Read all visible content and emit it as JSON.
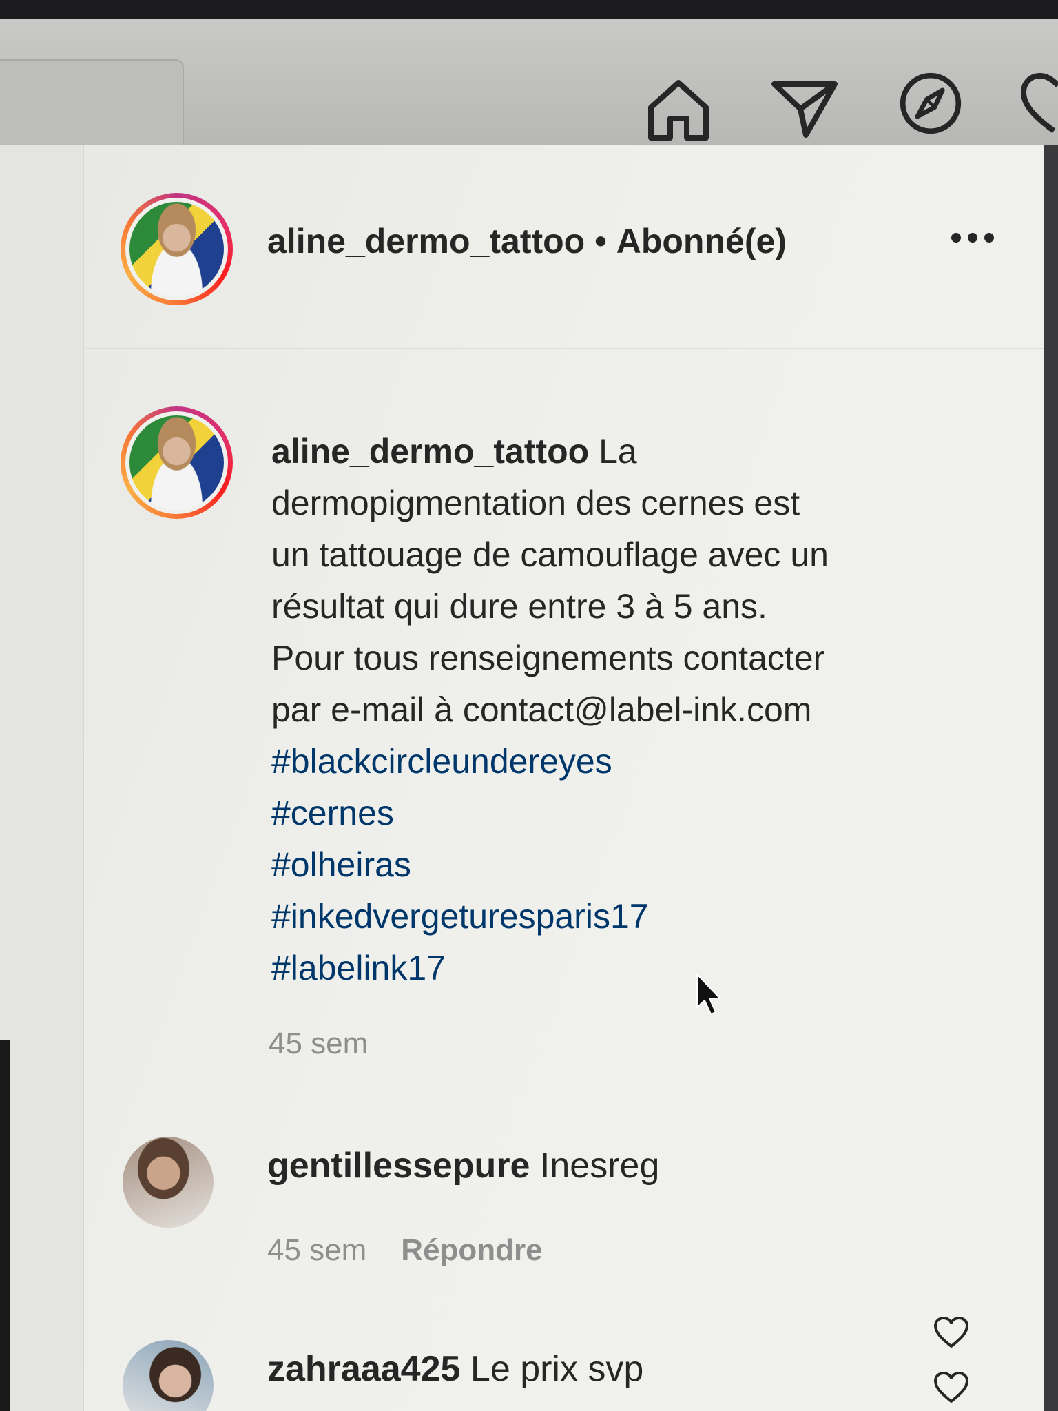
{
  "nav": {
    "icons": [
      "home-icon",
      "direct-message-icon",
      "explore-icon",
      "activity-heart-icon"
    ]
  },
  "post": {
    "author": "aline_dermo_tattoo",
    "separator": "•",
    "follow_status": "Abonné(e)",
    "more_icon": "more-options-icon",
    "caption_author": "aline_dermo_tattoo",
    "caption_lines": [
      "La",
      "dermopigmentation des cernes est",
      "un tattouage de camouflage avec un",
      "résultat qui dure entre 3 à 5 ans.",
      "Pour tous renseignements contacter",
      "par e-mail à contact@label-ink.com"
    ],
    "hashtags": [
      "#blackcircleundereyes",
      "#cernes",
      "#olheiras",
      "#inkedvergeturesparis17",
      "#labelink17"
    ],
    "time": "45 sem"
  },
  "comments": [
    {
      "username": "gentillessepure",
      "text": "Inesreg",
      "time": "45 sem",
      "reply_label": "Répondre"
    },
    {
      "username": "zahraaa425",
      "text": "Le prix svp"
    }
  ],
  "colors": {
    "text": "#262626",
    "muted": "#8e8e8e",
    "hashtag": "#00376b",
    "ring_start": "#c13584",
    "ring_end": "#fcaf45"
  }
}
